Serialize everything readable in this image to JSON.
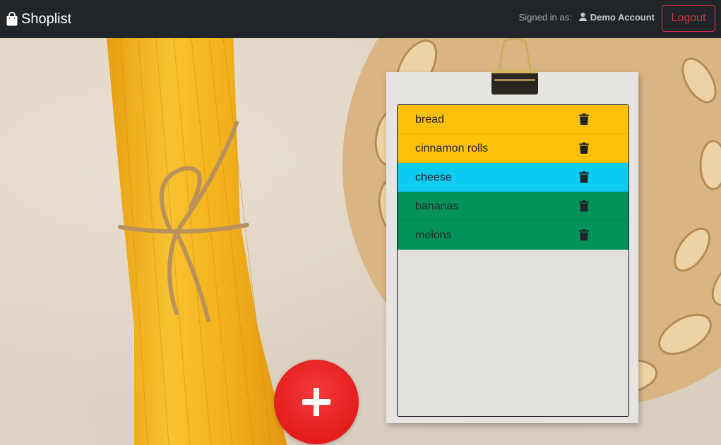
{
  "navbar": {
    "brand": "Shoplist",
    "brand_icon": "shopping-bag-icon",
    "signed_in_label": "Signed in as:",
    "user_icon": "person-icon",
    "account_name": "Demo Account",
    "logout_label": "Logout"
  },
  "shopping_list": {
    "items": [
      {
        "label": "bread",
        "color": "#ffc107"
      },
      {
        "label": "cinnamon rolls",
        "color": "#ffc107"
      },
      {
        "label": "cheese",
        "color": "#0dcaf0"
      },
      {
        "label": "bananas",
        "color": "#03935a"
      },
      {
        "label": "melons",
        "color": "#03935a"
      }
    ],
    "delete_icon": "trash-icon"
  },
  "add_button": {
    "icon": "plus-icon"
  },
  "colors": {
    "navbar_bg": "#212529",
    "logout": "#dc3545",
    "add_button": "#e41d1d"
  }
}
